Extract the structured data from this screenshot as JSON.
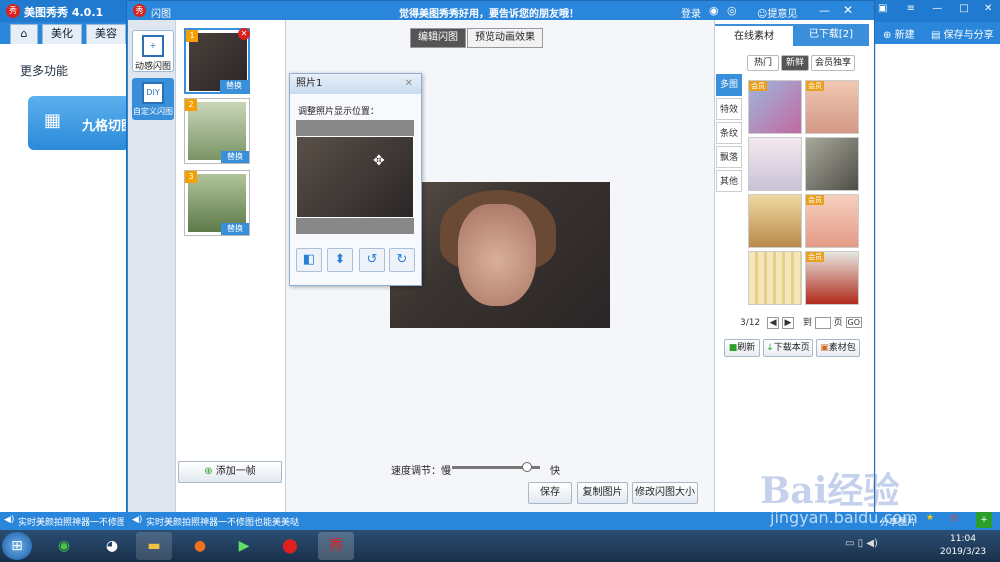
{
  "main_window": {
    "logo": "秀",
    "title": "美图秀秀 4.0.1",
    "tabs": [
      "美化",
      "美容"
    ],
    "right_buttons": {
      "new": "新建",
      "save_share": "保存与分享"
    },
    "section_title": "更多功能",
    "feature_card": "九格切图"
  },
  "dialog": {
    "title": "闪图",
    "banner": "觉得美图秀秀好用，要告诉您的朋友哦！",
    "title_actions": {
      "login": "登录",
      "feedback": "提意见"
    },
    "modes": [
      {
        "label": "动感闪图",
        "icon": "+"
      },
      {
        "label": "自定义闪图",
        "icon": "DIY"
      }
    ],
    "frames": [
      {
        "num": "1",
        "replace": "替换"
      },
      {
        "num": "2",
        "replace": "替换"
      },
      {
        "num": "3",
        "replace": "替换"
      }
    ],
    "add_frame": "添加一帧",
    "canvas_tabs": {
      "edit": "编辑闪图",
      "preview": "预览动画效果"
    },
    "popup": {
      "title": "照片1",
      "hint": "调整照片显示位置："
    },
    "speed": {
      "label": "速度调节：慢",
      "fast": "快",
      "level": 0.85
    },
    "buttons": {
      "save": "保存",
      "copy": "复制图片",
      "resize": "修改闪图大小"
    }
  },
  "material": {
    "tabs": {
      "online": "在线素材",
      "downloaded": "已下载[2]"
    },
    "filters": [
      "热门",
      "新鲜",
      "会员独享"
    ],
    "categories": [
      "多图",
      "特效",
      "条纹",
      "飘落",
      "其他"
    ],
    "badge": "会员",
    "pager": {
      "current": "3/12",
      "to": "到",
      "page": "页",
      "go": "GO"
    },
    "actions": {
      "refresh": "刷新",
      "download_page": "下载本页",
      "pack": "素材包"
    }
  },
  "status": {
    "left_text": "实时美颜拍照神器一不修图也能美美哒",
    "dialog_text": "实时美颜拍照神器一不修图也能美美哒",
    "share": "分享图片"
  },
  "taskbar": {
    "time": "11:04",
    "date": "2019/3/23"
  },
  "watermark": {
    "brand": "Bai经验",
    "url": "jingyan.baidu.com"
  }
}
